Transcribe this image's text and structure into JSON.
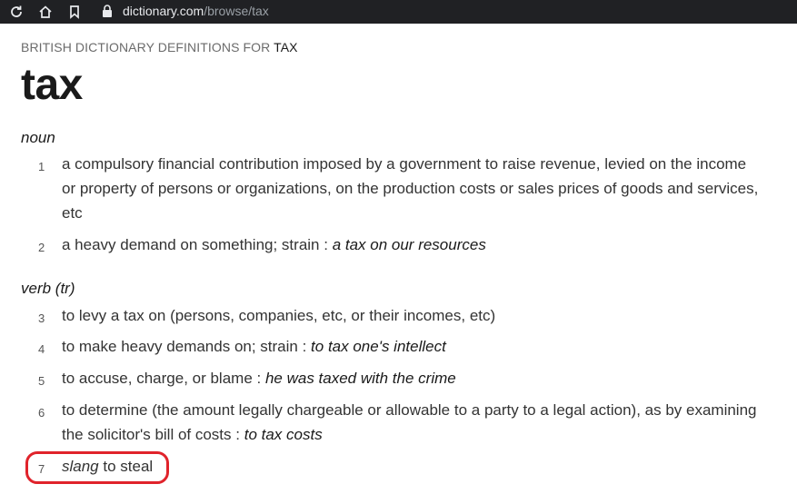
{
  "browser": {
    "url_domain": "dictionary.com",
    "url_path": "/browse/tax"
  },
  "entry": {
    "kicker": "BRITISH DICTIONARY DEFINITIONS FOR",
    "kicker_word": "TAX",
    "headword": "tax",
    "sections": [
      {
        "pos": "noun",
        "defs": [
          {
            "num": "1",
            "text": "a compulsory financial contribution imposed by a government to raise revenue, levied on the income or property of persons or organizations, on the production costs or sales prices of goods and services, etc"
          },
          {
            "num": "2",
            "text": "a heavy demand on something; strain : ",
            "example": "a tax on our resources"
          }
        ]
      },
      {
        "pos": "verb (tr)",
        "defs": [
          {
            "num": "3",
            "text": "to levy a tax on (persons, companies, etc, or their incomes, etc)"
          },
          {
            "num": "4",
            "text": "to make heavy demands on; strain : ",
            "example": "to tax one's intellect"
          },
          {
            "num": "5",
            "text": "to accuse, charge, or blame : ",
            "example": "he was taxed with the crime"
          },
          {
            "num": "6",
            "text": "to determine (the amount legally chargeable or allowable to a party to a legal action), as by examining the solicitor's bill of costs : ",
            "example": "to tax costs"
          },
          {
            "num": "7",
            "label": "slang",
            "text": " to steal"
          }
        ]
      }
    ]
  },
  "colors": {
    "annotation_circle": "#e0232b",
    "topbar": "#202124"
  }
}
